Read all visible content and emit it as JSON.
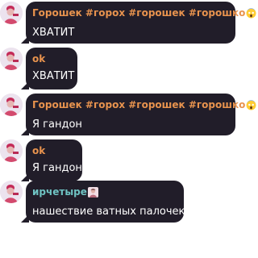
{
  "messages": [
    {
      "author": "Горошек #горох #горошек #горошко",
      "author_emoji": "screaming-face",
      "text": "ХВАТИТ"
    },
    {
      "author": "ok",
      "author_emoji": "",
      "text": "ХВАТИТ"
    },
    {
      "author": "Горошек #горох #горошек #горошко",
      "author_emoji": "screaming-face",
      "text": "Я гандон"
    },
    {
      "author": "ok",
      "author_emoji": "",
      "text": "Я гандон"
    },
    {
      "author": "ирчетыре",
      "author_emoji": "person-emoji",
      "text": "нашествие ватных палочек"
    }
  ],
  "colors": {
    "bubble": "#211d29",
    "author_orange": "#e8934e",
    "author_teal": "#6fc3c3",
    "text": "#ffffff"
  }
}
